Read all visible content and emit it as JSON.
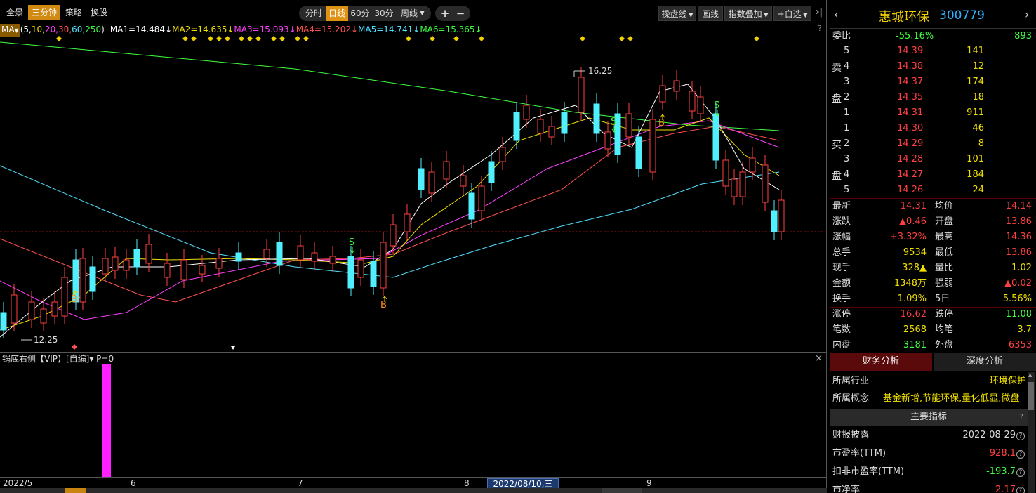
{
  "toolbar": {
    "left_buttons": [
      "全景",
      "三分钟",
      "策略",
      "换股"
    ],
    "active_left": "三分钟",
    "periods": [
      "分时",
      "日线",
      "60分",
      "30分",
      "周线"
    ],
    "active_period": "日线",
    "zoom_in": "+",
    "zoom_out": "−",
    "operate_line": "操盘线",
    "draw_line": "画线",
    "index_overlay": "指数叠加",
    "add_watch": "自选"
  },
  "ma_bar": {
    "button": "MA",
    "params_open": "(",
    "params": [
      {
        "text": "5,",
        "color": "#ffffff"
      },
      {
        "text": "10,",
        "color": "#f0e000"
      },
      {
        "text": "20,",
        "color": "#ff40ff"
      },
      {
        "text": "30,",
        "color": "#ff5050"
      },
      {
        "text": "60,",
        "color": "#50e0ff"
      },
      {
        "text": "250",
        "color": "#40ff40"
      }
    ],
    "params_close": ")",
    "items": [
      {
        "text": "MA1=14.484↓",
        "color": "#ffffff"
      },
      {
        "text": "MA2=14.635↓",
        "color": "#f0e000"
      },
      {
        "text": "MA3=15.093↓",
        "color": "#ff40ff"
      },
      {
        "text": "MA4=15.202↓",
        "color": "#ff5050"
      },
      {
        "text": "MA5=14.741↓",
        "color": "#50e0ff"
      },
      {
        "text": "MA6=15.365↓",
        "color": "#40ff40"
      }
    ],
    "help": "?"
  },
  "main_chart": {
    "high_label": "16.25",
    "low_label": "12.25",
    "signals": {
      "buy": "B",
      "sell": "S"
    }
  },
  "sub_chart": {
    "title": "锅底右侧【VIP】[自编]▾  P=0",
    "close": "×"
  },
  "x_axis": {
    "labels": [
      "2022/5",
      "6",
      "7",
      "8",
      "9"
    ],
    "cursor_date": "2022/08/10,三"
  },
  "panel": {
    "stock_name": "惠城环保",
    "stock_code": "300779",
    "weibi_label": "委比",
    "weibi_value": "-55.16%",
    "weibi_vol": "893",
    "sell_side_label": [
      "卖",
      "盘"
    ],
    "buy_side_label": [
      "买",
      "盘"
    ],
    "sell_orders": [
      {
        "idx": "5",
        "price": "14.39",
        "vol": "141"
      },
      {
        "idx": "4",
        "price": "14.38",
        "vol": "12"
      },
      {
        "idx": "3",
        "price": "14.37",
        "vol": "174"
      },
      {
        "idx": "2",
        "price": "14.35",
        "vol": "18"
      },
      {
        "idx": "1",
        "price": "14.31",
        "vol": "911"
      }
    ],
    "buy_orders": [
      {
        "idx": "1",
        "price": "14.30",
        "vol": "46"
      },
      {
        "idx": "2",
        "price": "14.29",
        "vol": "8"
      },
      {
        "idx": "3",
        "price": "14.28",
        "vol": "101"
      },
      {
        "idx": "4",
        "price": "14.27",
        "vol": "184"
      },
      {
        "idx": "5",
        "price": "14.26",
        "vol": "24"
      }
    ],
    "quotes": [
      {
        "l1": "最新",
        "v1": "14.31",
        "c1": "red",
        "l2": "均价",
        "v2": "14.14",
        "c2": "red"
      },
      {
        "l1": "涨跌",
        "v1": "▲0.46",
        "c1": "red",
        "l2": "开盘",
        "v2": "13.86",
        "c2": "red"
      },
      {
        "l1": "涨幅",
        "v1": "+3.32%",
        "c1": "red",
        "l2": "最高",
        "v2": "14.36",
        "c2": "red"
      },
      {
        "l1": "总手",
        "v1": "9534",
        "c1": "yellow",
        "l2": "最低",
        "v2": "13.86",
        "c2": "red"
      },
      {
        "l1": "现手",
        "v1": "328▲",
        "c1": "yellow",
        "l2": "量比",
        "v2": "1.02",
        "c2": "yellow"
      },
      {
        "l1": "金额",
        "v1": "1348万",
        "c1": "yellow",
        "l2": "强弱",
        "v2": "▲0.02",
        "c2": "red"
      },
      {
        "l1": "换手",
        "v1": "1.09%",
        "c1": "yellow",
        "l2": "5日",
        "v2": "5.56%",
        "c2": "yellow"
      },
      {
        "l1": "涨停",
        "v1": "16.62",
        "c1": "red",
        "l2": "跌停",
        "v2": "11.08",
        "c2": "green"
      },
      {
        "l1": "笔数",
        "v1": "2568",
        "c1": "yellow",
        "l2": "均笔",
        "v2": "3.7",
        "c2": "yellow"
      },
      {
        "l1": "内盘",
        "v1": "3181",
        "c1": "green",
        "l2": "外盘",
        "v2": "6353",
        "c2": "red"
      }
    ],
    "tabs": [
      "财务分析",
      "深度分析"
    ],
    "industry_label": "所属行业",
    "industry_value": "环境保护",
    "concept_label": "所属概念",
    "concept_value": "基金新增,节能环保,量化低显,微盘",
    "key_header": "主要指标",
    "key_rows": [
      {
        "label": "财报披露",
        "value": "2022-08-29",
        "color": "#dddddd"
      },
      {
        "label": "市盈率(TTM)",
        "value": "928.1",
        "color": "#ff4040"
      },
      {
        "label": "扣非市盈率(TTM)",
        "value": "-193.7",
        "color": "#3fff3f"
      },
      {
        "label": "市净率",
        "value": "2.17",
        "color": "#ff4040"
      }
    ]
  }
}
